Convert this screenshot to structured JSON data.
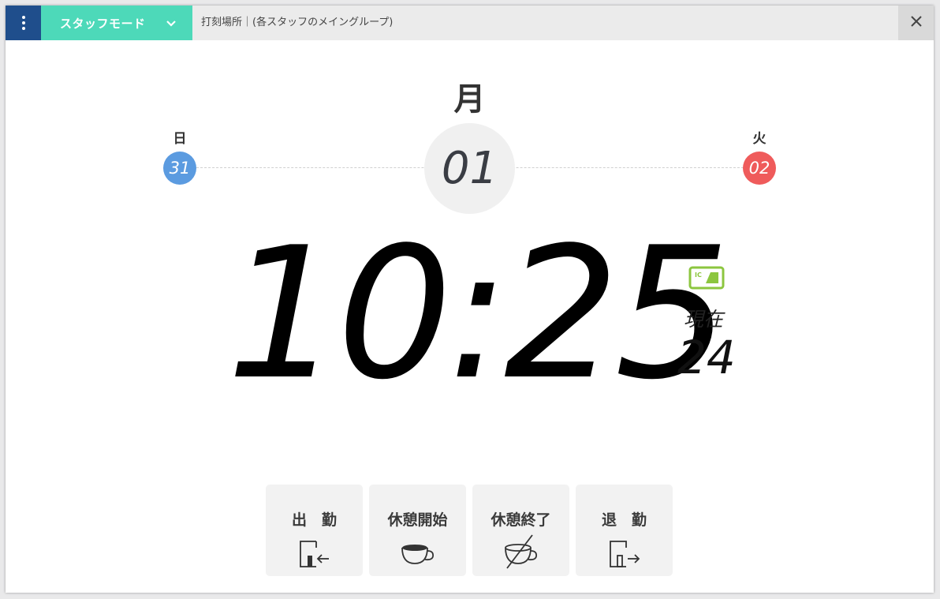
{
  "topbar": {
    "mode_label": "スタッフモード",
    "place_label": "打刻場所｜(各スタッフのメイングループ)"
  },
  "days": {
    "prev": {
      "name": "日",
      "number": "31"
    },
    "current": {
      "name": "月",
      "number": "01"
    },
    "next": {
      "name": "火",
      "number": "02"
    }
  },
  "clock": {
    "time": "10:25"
  },
  "status": {
    "now_label": "現在",
    "count": "24",
    "ic_label": "IC"
  },
  "actions": [
    {
      "label": "出　勤"
    },
    {
      "label": "休憩開始"
    },
    {
      "label": "休憩終了"
    },
    {
      "label": "退　勤"
    }
  ],
  "colors": {
    "menu": "#1f4e8c",
    "mode": "#4dd9b9",
    "prev_day": "#5b9be0",
    "next_day": "#ef5b5b",
    "ic": "#8cc63f"
  }
}
